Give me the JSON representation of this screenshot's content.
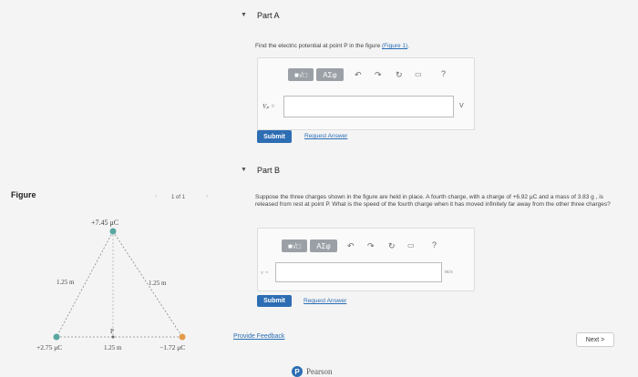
{
  "figure_panel": {
    "title": "Figure",
    "pager": "1 of 1",
    "labels": {
      "top_charge": "+7.45 μC",
      "left_side": "1.25 m",
      "right_side": "1.25 m",
      "point_p": "P",
      "bottom_left_charge": "+2.75 μC",
      "bottom_mid": "1.25 m",
      "bottom_right_charge": "−1.72 μC"
    }
  },
  "part_a": {
    "header": "Part A",
    "question_text": "Find the electric potential at point P in the figure ",
    "figure_link": "(Figure 1)",
    "question_end": ".",
    "toolbar_symbols": "ΑΣφ",
    "var_label": "Vₚ =",
    "unit": "V",
    "submit": "Submit",
    "request_answer": "Request Answer"
  },
  "part_b": {
    "header": "Part B",
    "question": "Suppose the three charges shown in the figure are held in place. A fourth charge, with a charge of +6.92 μC and a mass of 3.83 g , is released from rest at point P. What is the speed of the fourth charge when it has moved infinitely far away from the other three charges?",
    "toolbar_symbols": "ΑΣφ",
    "var_label": "v =",
    "unit": "m/s",
    "submit": "Submit",
    "request_answer": "Request Answer"
  },
  "footer": {
    "feedback": "Provide Feedback",
    "next": "Next >",
    "brand": "Pearson"
  },
  "colors": {
    "submit_blue": "#2d6db3",
    "link_blue": "#2a6db5",
    "charge_teal": "#5aa6a0",
    "charge_orange": "#e39a4a"
  }
}
